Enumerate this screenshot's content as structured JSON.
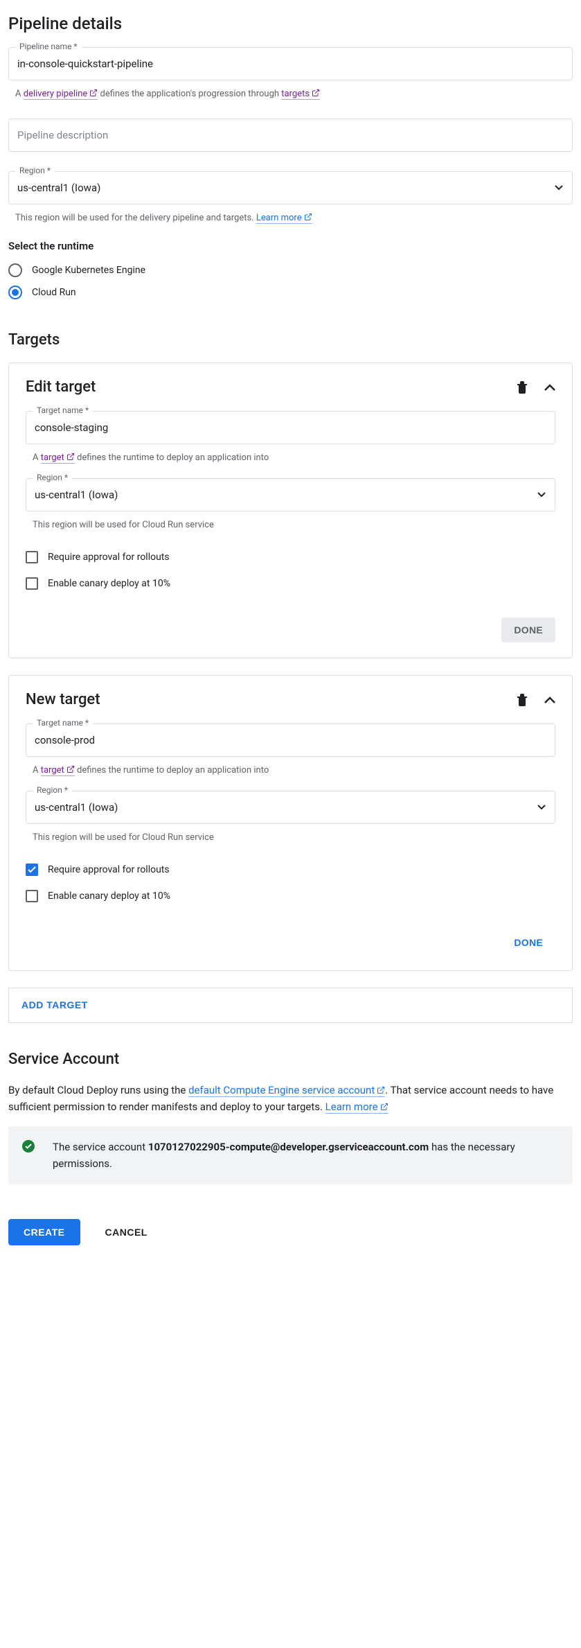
{
  "pipeline_details": {
    "heading": "Pipeline details",
    "name_label": "Pipeline name *",
    "name_value": "in-console-quickstart-pipeline",
    "name_helper_prefix": "A ",
    "name_helper_link": "delivery pipeline",
    "name_helper_mid": " defines the application's progression through ",
    "name_helper_link2": "targets",
    "desc_placeholder": "Pipeline description",
    "region_label": "Region *",
    "region_value": "us-central1 (Iowa)",
    "region_helper_text": "This region will be used for the delivery pipeline and targets. ",
    "region_learn_more": "Learn more"
  },
  "runtime": {
    "title": "Select the runtime",
    "options": {
      "gke": "Google Kubernetes Engine",
      "run": "Cloud Run"
    }
  },
  "targets": {
    "heading": "Targets",
    "t1": {
      "title": "Edit target",
      "name_label": "Target name *",
      "name_value": "console-staging",
      "helper_prefix": "A ",
      "helper_link": "target",
      "helper_suffix": " defines the runtime to deploy an application into",
      "region_label": "Region *",
      "region_value": "us-central1 (Iowa)",
      "region_helper": "This region will be used for Cloud Run service",
      "opt_approval": "Require approval for rollouts",
      "opt_canary": "Enable canary deploy at 10%",
      "done": "DONE"
    },
    "t2": {
      "title": "New target",
      "name_label": "Target name *",
      "name_value": "console-prod",
      "helper_prefix": "A ",
      "helper_link": "target",
      "helper_suffix": " defines the runtime to deploy an application into",
      "region_label": "Region *",
      "region_value": "us-central1 (Iowa)",
      "region_helper": "This region will be used for Cloud Run service",
      "opt_approval": "Require approval for rollouts",
      "opt_canary": "Enable canary deploy at 10%",
      "done": "DONE"
    },
    "add_target": "ADD TARGET"
  },
  "service_account": {
    "heading": "Service Account",
    "text_prefix": "By default Cloud Deploy runs using the ",
    "text_link": "default Compute Engine service account",
    "text_suffix": ". That service account needs to have sufficient permission to render manifests and deploy to your targets. ",
    "learn_more": "Learn more",
    "banner_prefix": "The service account ",
    "banner_account": "1070127022905-compute@developer.gserviceaccount.com",
    "banner_suffix": " has the necessary permissions."
  },
  "footer": {
    "create": "CREATE",
    "cancel": "CANCEL"
  }
}
